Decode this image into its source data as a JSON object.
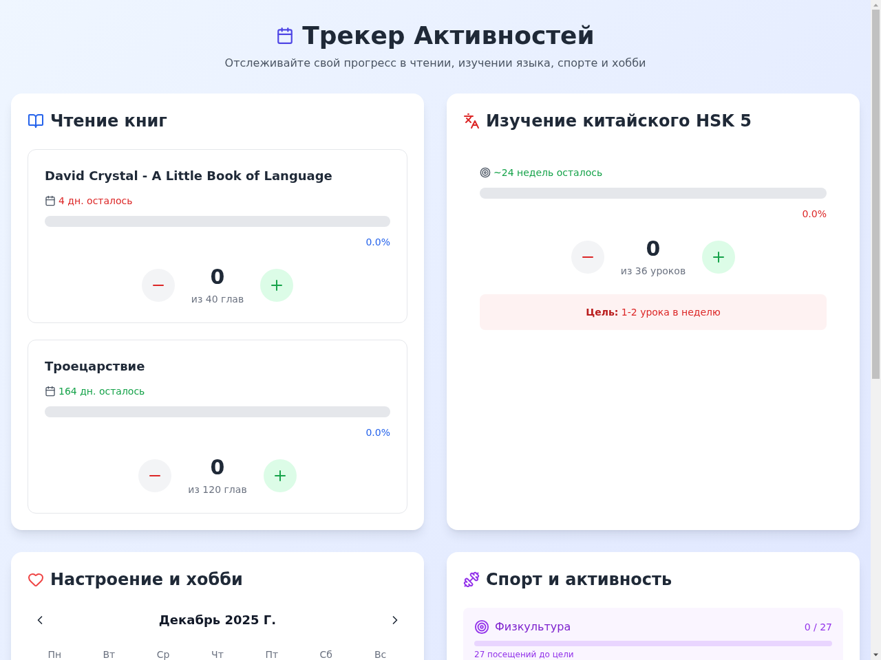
{
  "header": {
    "title": "Трекер Активностей",
    "subtitle": "Отслеживайте свой прогресс в чтении, изучении языка, спорте и хобби"
  },
  "reading": {
    "title": "Чтение книг",
    "books": [
      {
        "title": "David Crystal - A Little Book of Language",
        "deadline": "4 дн. осталось",
        "color": "#dc2626",
        "level": 0,
        "percent": "0.0%",
        "count": "0",
        "total": "из 40 глав"
      },
      {
        "title": "Троецарствие",
        "deadline": "164 дн. осталось",
        "color": "#16a34a",
        "level": 0,
        "percent": "0.0%",
        "count": "0",
        "total": "из 120 глав"
      }
    ]
  },
  "language": {
    "title": "Изучение китайского HSK 5",
    "remaining": "~24 недель осталось",
    "level": 0,
    "percent": "0.0%",
    "count": "0",
    "total": "из 36 уроков",
    "goal": "**Цель:** 1-2 урока в неделю"
  },
  "mood": {
    "title": "Настроение и хобби",
    "calendar": {
      "month": "Декабрь 2025 Г.",
      "weekdays": [
        "Пн",
        "Вт",
        "Ср",
        "Чт",
        "Пт",
        "Сб",
        "Вс"
      ]
    }
  },
  "sport": {
    "title": "Спорт и активность",
    "activities": [
      {
        "name": "Физкультура",
        "progress": "0 / 27",
        "level": 0,
        "note": "27 посещений до цели"
      }
    ]
  }
}
